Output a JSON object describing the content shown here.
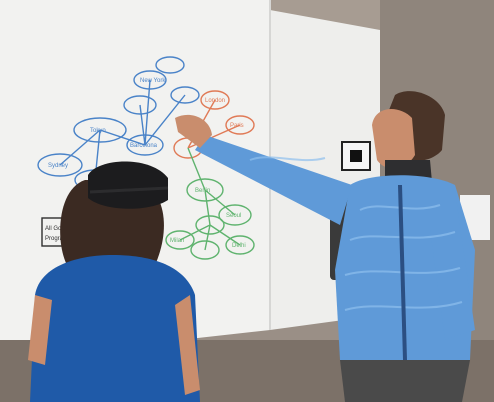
{
  "scene": {
    "description_visible_text": {
      "whiteboard_labels": [
        "Tokyo",
        "Sydney",
        "Barcelona",
        "New York",
        "London",
        "Paris",
        "Berlin",
        "Seoul",
        "Milan",
        "Delhi",
        "All Goals",
        "Program"
      ]
    },
    "palette": {
      "wall": "#9a8f86",
      "whiteboard": "#f2f2f0",
      "hair": "#3b2a22",
      "shirt_woman": "#1f5aa8",
      "avatar_shirt": "#5f9ad8",
      "skin": "#c98d6d",
      "headset": "#1c1c1e",
      "ink_blue": "#4a83c8",
      "ink_green": "#5fb36e",
      "ink_orange": "#e07a56",
      "ink_dark": "#2f2f2f"
    }
  }
}
